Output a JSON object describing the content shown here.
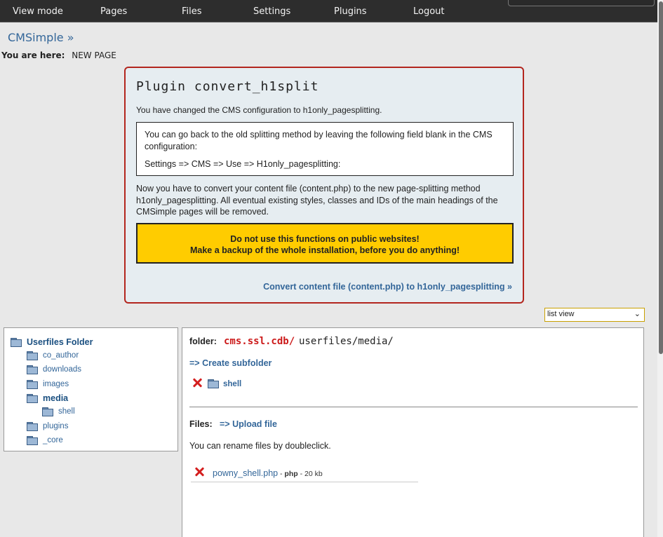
{
  "topnav": {
    "items": [
      "View mode",
      "Pages",
      "Files",
      "Settings",
      "Plugins",
      "Logout"
    ]
  },
  "site": {
    "title": "CMSimple »",
    "breadcrumb_label": "You are here:",
    "breadcrumb_page": "NEW PAGE"
  },
  "plugin": {
    "title": "Plugin convert_h1split",
    "changed_msg": "You have changed the CMS configuration to h1only_pagesplitting.",
    "info_line1": "You can go back to the old splitting method by leaving the following field blank in the CMS configuration:",
    "info_line2": "Settings => CMS => Use => H1only_pagesplitting:",
    "convert_msg": "Now you have to convert your content file (content.php) to the new page-splitting method h1only_pagesplitting. All eventual existing styles, classes and IDs of the main headings of the CMSimple pages will be removed.",
    "warning_line1": "Do not use this functions on public websites!",
    "warning_line2": "Make a backup of the whole installation, before you do anything!",
    "convert_link": "Convert content file (content.php) to h1only_pagesplitting »"
  },
  "view_select": {
    "selected": "list view"
  },
  "tree": {
    "root": "Userfiles Folder",
    "items": [
      "co_author",
      "downloads",
      "images",
      "media",
      "shell",
      "plugins",
      "_core"
    ]
  },
  "main": {
    "folder_label": "folder:",
    "folder_host": "cms.ssl.cdb/",
    "folder_path": "userfiles/media/",
    "create_subfolder": "=> Create subfolder",
    "subfolder_name": "shell",
    "files_label": "Files:",
    "upload_link": "=> Upload file",
    "rename_hint": "You can rename files by doubleclick.",
    "files": [
      {
        "name": "powny_shell.php",
        "sep1": " - ",
        "type": "php",
        "sep2": " - ",
        "size": "20 kb"
      }
    ]
  },
  "colors": {
    "accent_link": "#336699",
    "warning_bg": "#ffcc00",
    "plugin_border": "#b3261e",
    "delete_icon": "#d41f1f"
  }
}
